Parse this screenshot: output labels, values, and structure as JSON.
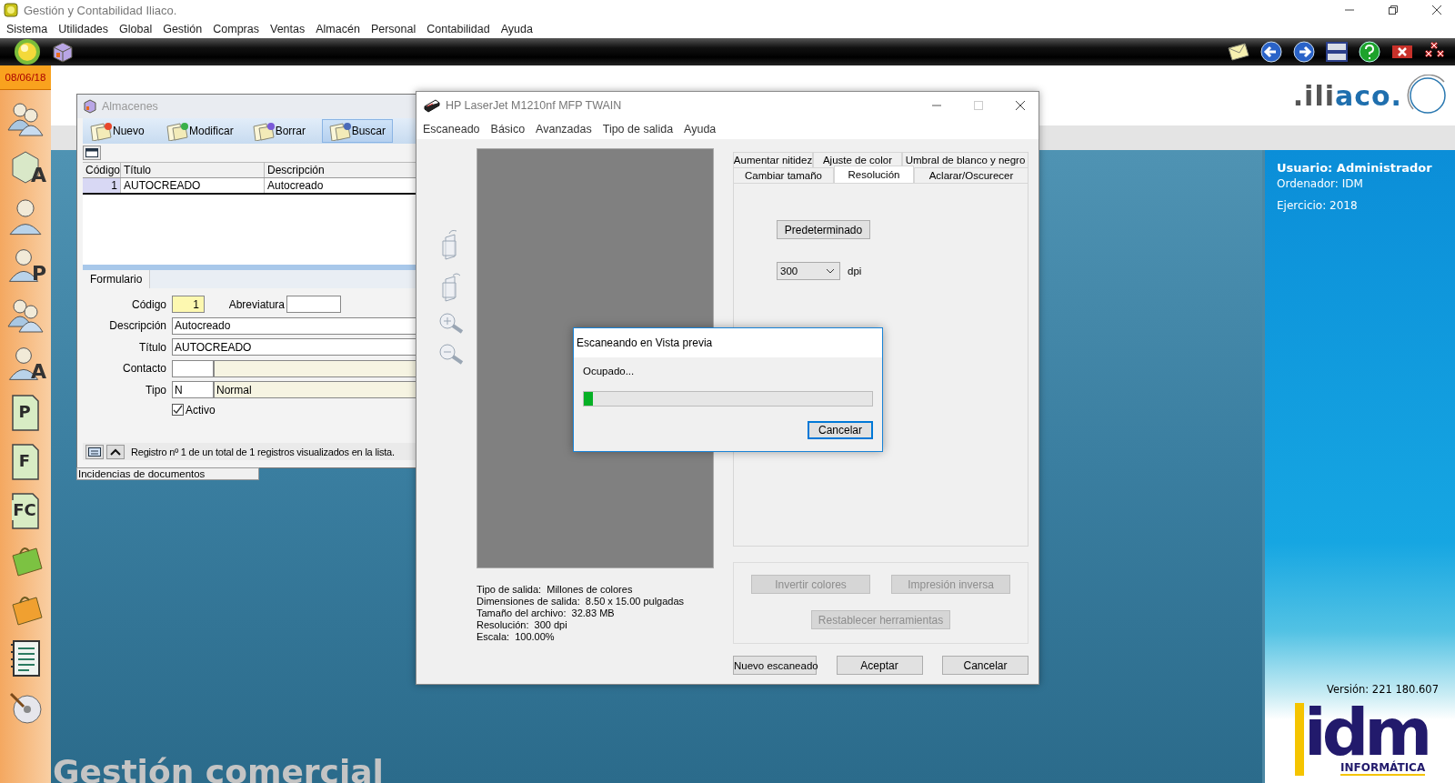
{
  "window": {
    "title": "Gestión y Contabilidad Iliaco."
  },
  "menu": [
    "Sistema",
    "Utilidades",
    "Global",
    "Gestión",
    "Compras",
    "Ventas",
    "Almacén",
    "Personal",
    "Contabilidad",
    "Ayuda"
  ],
  "sidebar": {
    "date": "08/06/18",
    "items": [
      {
        "kind": "group"
      },
      {
        "kind": "letter",
        "glyph": "A"
      },
      {
        "kind": "person"
      },
      {
        "kind": "person-letter",
        "glyph": "P"
      },
      {
        "kind": "group"
      },
      {
        "kind": "person-letter",
        "glyph": "A"
      },
      {
        "kind": "doc-letter",
        "glyph": "P"
      },
      {
        "kind": "doc-letter",
        "glyph": "F"
      },
      {
        "kind": "doc-letter",
        "glyph": "FC"
      },
      {
        "kind": "bag",
        "color": "#7cc242"
      },
      {
        "kind": "bag",
        "color": "#f0a030"
      },
      {
        "kind": "list"
      },
      {
        "kind": "disc"
      }
    ]
  },
  "header": {
    "logo_prefix": ".ili",
    "logo_suffix": "aco."
  },
  "info": {
    "user": "Usuario: Administrador",
    "computer": "Ordenador: IDM",
    "year": "Ejercicio: 2018",
    "version": "Versión: 221 180.607"
  },
  "brand": {
    "mark": "idm",
    "sub": "INFORMÁTICA"
  },
  "module_title": "Gestión comercial",
  "almacenes": {
    "title": "Almacenes",
    "toolbar": [
      {
        "label": "Nuevo",
        "selected": false
      },
      {
        "label": "Modificar",
        "selected": false
      },
      {
        "label": "Borrar",
        "selected": false
      },
      {
        "label": "Buscar",
        "selected": true
      }
    ],
    "columns": [
      "Código",
      "Título",
      "Descripción"
    ],
    "rows": [
      {
        "cells": [
          "1",
          "AUTOCREADO",
          "Autocreado"
        ],
        "selected": true
      }
    ],
    "form_tab": "Formulario",
    "fields": [
      {
        "kind": "code",
        "label": "Código",
        "value": "1",
        "extra_label": "Abreviatura"
      },
      {
        "kind": "text",
        "label": "Descripción",
        "value": "Autocreado"
      },
      {
        "kind": "text",
        "label": "Título",
        "value": "AUTOCREADO"
      },
      {
        "kind": "lookup",
        "label": "Contacto"
      },
      {
        "kind": "lookup",
        "label": "Tipo",
        "code": "N",
        "name": "Normal"
      }
    ],
    "active": {
      "label": "Activo",
      "checked": true
    },
    "status": "Registro nº 1 de un total de 1 registros visualizados en la lista.",
    "bottom_tab": "Incidencias de documentos"
  },
  "twain": {
    "title": "HP LaserJet M1210nf MFP TWAIN",
    "menu": [
      "Escaneado",
      "Básico",
      "Avanzadas",
      "Tipo de salida",
      "Ayuda"
    ],
    "tab_rows": [
      [
        {
          "label": "Aumentar nitidez",
          "selected": false
        },
        {
          "label": "Ajuste de color",
          "selected": false
        },
        {
          "label": "Umbral de blanco y negro",
          "selected": false
        }
      ],
      [
        {
          "label": "Cambiar tamaño",
          "selected": false
        },
        {
          "label": "Resolución",
          "selected": true
        },
        {
          "label": "Aclarar/Oscurecer",
          "selected": false
        }
      ]
    ],
    "default_button": "Predeterminado",
    "resolution": "300",
    "unit": "dpi",
    "details": [
      "Tipo de salida:  Millones de colores",
      "Dimensiones de salida:  8.50 x 15.00 pulgadas",
      "Tamaño del archivo:  32.83 MB",
      "Resolución:  300 dpi",
      "Escala:  100.00%"
    ],
    "tools": [
      {
        "label": "Invertir colores",
        "disabled": true
      },
      {
        "label": "Impresión inversa",
        "disabled": true
      },
      {
        "label": "Restablecer herramientas",
        "disabled": true
      }
    ],
    "buttons": [
      "Nuevo escaneado",
      "Aceptar",
      "Cancelar"
    ]
  },
  "dialog": {
    "title": "Escaneando en Vista previa",
    "message": "Ocupado...",
    "level": 0.03,
    "button": "Cancelar"
  }
}
